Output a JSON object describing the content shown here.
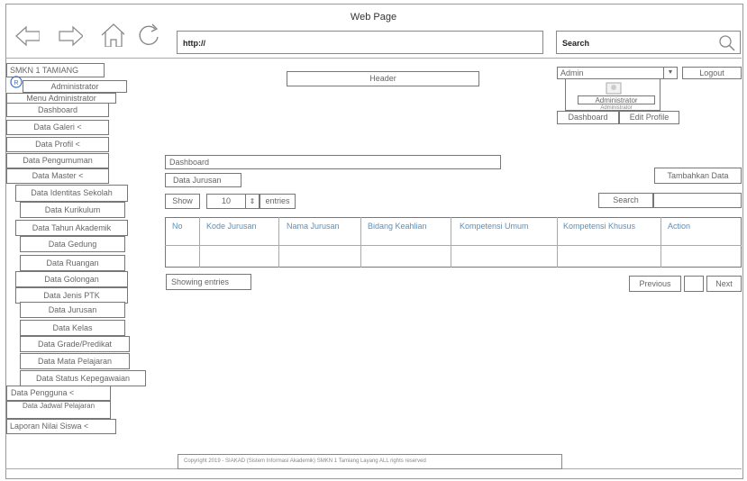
{
  "window": {
    "title": "Web Page"
  },
  "browser": {
    "url": "http://",
    "search_placeholder": "Search"
  },
  "sidebar": {
    "school": "SMKN 1 TAMIANG",
    "admin_label": "Administrator",
    "menu_title": "Menu Administrator",
    "items": {
      "dashboard": "Dashboard",
      "data_galeri": "Data Galeri <",
      "data_profil": "Data Profil <",
      "data_pengumuman": "Data Pengumuman",
      "data_master": "Data Master <",
      "identitas_sekolah": "Data Identitas Sekolah",
      "kurikulum": "Data Kurikulum",
      "tahun_akademik": "Data Tahun Akademik",
      "gedung": "Data Gedung",
      "ruangan": "Data Ruangan",
      "golongan": "Data Golongan",
      "jenis_ptk": "Data Jenis PTK",
      "jurusan": "Data Jurusan",
      "kelas": "Data Kelas",
      "grade_predikat": "Data Grade/Predikat",
      "mata_pelajaran": "Data Mata Pelajaran",
      "status_kepegawaian": "Data Status Kepegawaian",
      "data_pengguna": "Data Pengguna <",
      "jadwal_pelajaran": "Data Jadwal Pelajaran",
      "laporan_nilai": "Laporan Nilai Siswa <"
    }
  },
  "header": {
    "label": "Header"
  },
  "user_panel": {
    "select_value": "Admin",
    "logout": "Logout",
    "name": "Administrator",
    "role": "Administrator",
    "dashboard_button": "Dashboard",
    "edit_profile_button": "Edit Profile"
  },
  "content": {
    "breadcrumb": "Dashboard",
    "section_title": "Data Jurusan",
    "add_button": "Tambahkan Data",
    "show_label": "Show",
    "entries_value": "10",
    "entries_label": "entries",
    "search_label": "Search",
    "table_headers": [
      "No",
      "Kode Jurusan",
      "Nama Jurusan",
      "Bidang Keahlian",
      "Kompetensi Umum",
      "Kompetensi Khusus",
      "Action"
    ],
    "showing_entries": "Showing entries",
    "previous": "Previous",
    "next": "Next"
  },
  "footer": {
    "text": "Copyright 2019 - SIAKAD (Sistem Informasi Akademik) SMKN 1 Tamiang Layang ALL rights reserved"
  },
  "colors": {
    "header_text": "#5a8fbd",
    "border": "#777777"
  }
}
